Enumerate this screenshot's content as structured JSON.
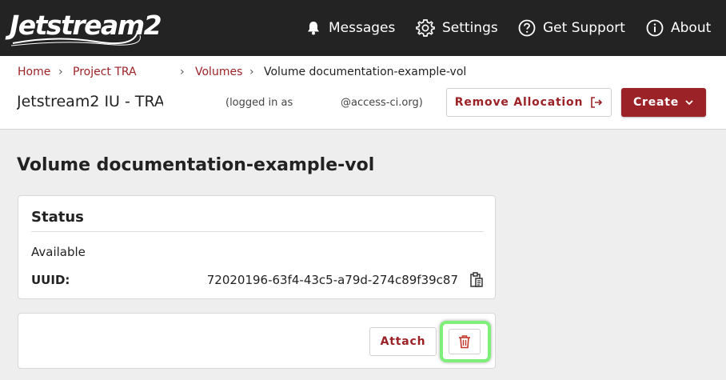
{
  "brand": {
    "logo_text": "Jetstream2"
  },
  "nav": {
    "messages": "Messages",
    "settings": "Settings",
    "support": "Get Support",
    "about": "About"
  },
  "breadcrumb": {
    "home": "Home",
    "project": "Project TRA",
    "volumes": "Volumes",
    "current": "Volume documentation-example-vol"
  },
  "project": {
    "title": "Jetstream2 IU - TRA",
    "logged_in_prefix": "(logged in as",
    "logged_in_suffix": "@access-ci.org)"
  },
  "actions": {
    "remove_allocation": "Remove Allocation",
    "create": "Create"
  },
  "volume": {
    "title": "Volume documentation-example-vol",
    "status_heading": "Status",
    "status_value": "Available",
    "uuid_label": "UUID:",
    "uuid_value": "72020196-63f4-43c5-a79d-274c89f39c87",
    "attach_label": "Attach"
  },
  "colors": {
    "accent": "#9b2226",
    "navbar": "#232323",
    "highlight": "#7ef07a"
  },
  "icons": {
    "messages": "bell-icon",
    "settings": "gear-icon",
    "support": "question-circle-icon",
    "about": "info-circle-icon",
    "remove": "sign-out-icon",
    "create": "chevron-down-icon",
    "copy": "clipboard-icon",
    "delete": "trash-icon"
  }
}
